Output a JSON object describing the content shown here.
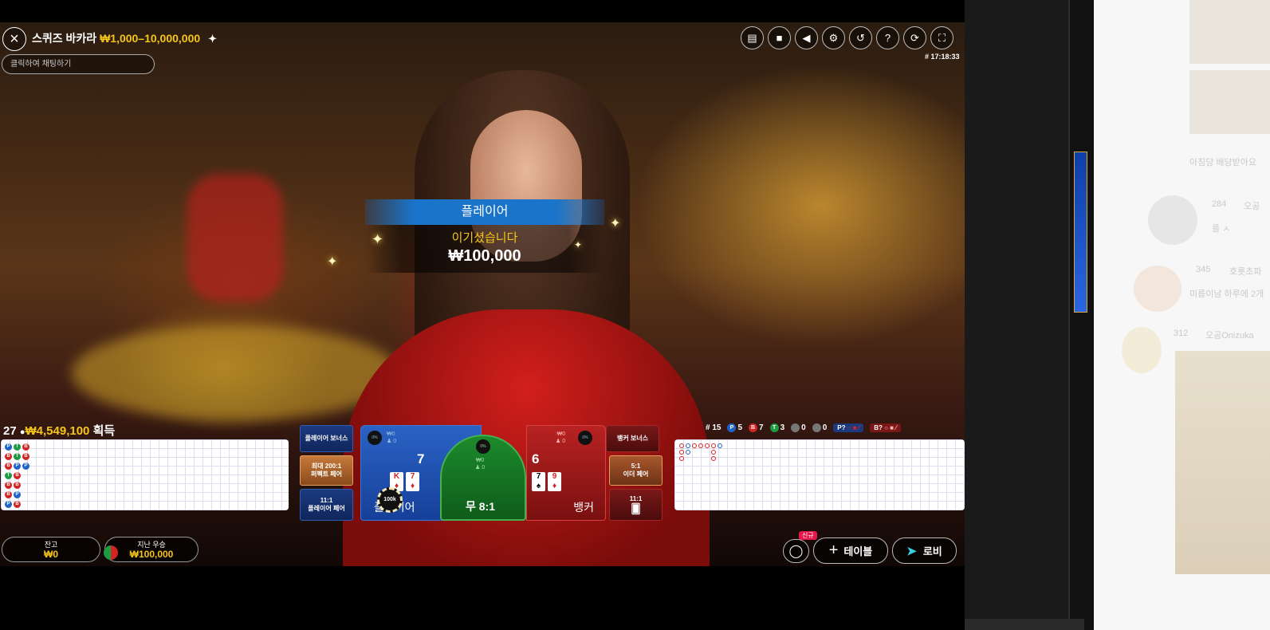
{
  "header": {
    "close_icon": "close-icon",
    "title": "스퀴즈 바카라",
    "limits": "₩1,000–10,000,000",
    "pin_icon": "pin-icon",
    "chat_placeholder": "클릭하여 채팅하기",
    "game_id": "# 17:18:33",
    "toolbar_icons": [
      "chat-icon",
      "video-icon",
      "volume-icon",
      "settings-icon",
      "history-icon",
      "help-icon",
      "refresh-icon",
      "fullscreen-icon"
    ]
  },
  "win": {
    "title": "플레이어",
    "message": "이기셨습니다",
    "amount": "₩100,000"
  },
  "players": {
    "count": "27",
    "amount": "₩4,549,100",
    "suffix": "획득"
  },
  "bead_road": [
    [
      "P",
      "T",
      "B"
    ],
    [
      "B",
      "T",
      "B"
    ],
    [
      "B",
      "P",
      "P"
    ],
    [
      "T",
      "B"
    ],
    [
      "B",
      "B"
    ],
    [
      "B",
      "P"
    ],
    [
      "P",
      "B"
    ]
  ],
  "stats": {
    "round": "# 15",
    "player_label": "P",
    "player": "5",
    "banker_label": "B",
    "banker": "7",
    "tie_label": "T",
    "tie": "3",
    "pp": "0",
    "bp": "0",
    "player_ask": "P?",
    "banker_ask": "B?"
  },
  "betting": {
    "player_bonus": "플레이어 보너스",
    "perfect_pair_ratio": "최대 200:1",
    "perfect_pair": "퍼펙트 페어",
    "player_pair_ratio": "11:1",
    "player_pair": "플레이어 페어",
    "player_label": "플레이어",
    "player_score": "7",
    "player_pct": "0%",
    "player_amount": "₩0",
    "player_count": "0",
    "tie_label": "무 8:1",
    "tie_pct": "0%",
    "tie_amount": "₩0",
    "tie_count": "0",
    "banker_label": "뱅커",
    "banker_score": "6",
    "banker_pct": "0%",
    "banker_amount": "₩0",
    "banker_count": "0",
    "banker_bonus": "뱅커 보너스",
    "either_pair_ratio": "5:1",
    "either_pair": "이더 페어",
    "banker_pair_ratio": "11:1",
    "chip_value": "100k",
    "player_cards": [
      {
        "rank": "K",
        "suit": "♦"
      },
      {
        "rank": "7",
        "suit": "♦"
      }
    ],
    "banker_cards": [
      {
        "rank": "7",
        "suit": "♠"
      },
      {
        "rank": "9",
        "suit": "♦"
      }
    ]
  },
  "footer": {
    "balance_label": "잔고",
    "balance": "₩0",
    "last_win_label": "지난 우승",
    "last_win": "₩100,000",
    "new_badge": "신규",
    "table_button": "테이블",
    "lobby_button": "로비"
  },
  "side_panel": {
    "line1": "아침당 배당받아요",
    "user1": "오공",
    "badge1": "284",
    "msg1": "를 ㅅ",
    "user2": "호롯초파",
    "badge2": "345",
    "msg2": "미름이남 하루에 2개",
    "user3": "오공Onizuka",
    "badge3": "312"
  },
  "colors": {
    "gold": "#f5c518",
    "player_blue": "#1e63c8",
    "banker_red": "#d32424",
    "tie_green": "#1c9c40"
  }
}
